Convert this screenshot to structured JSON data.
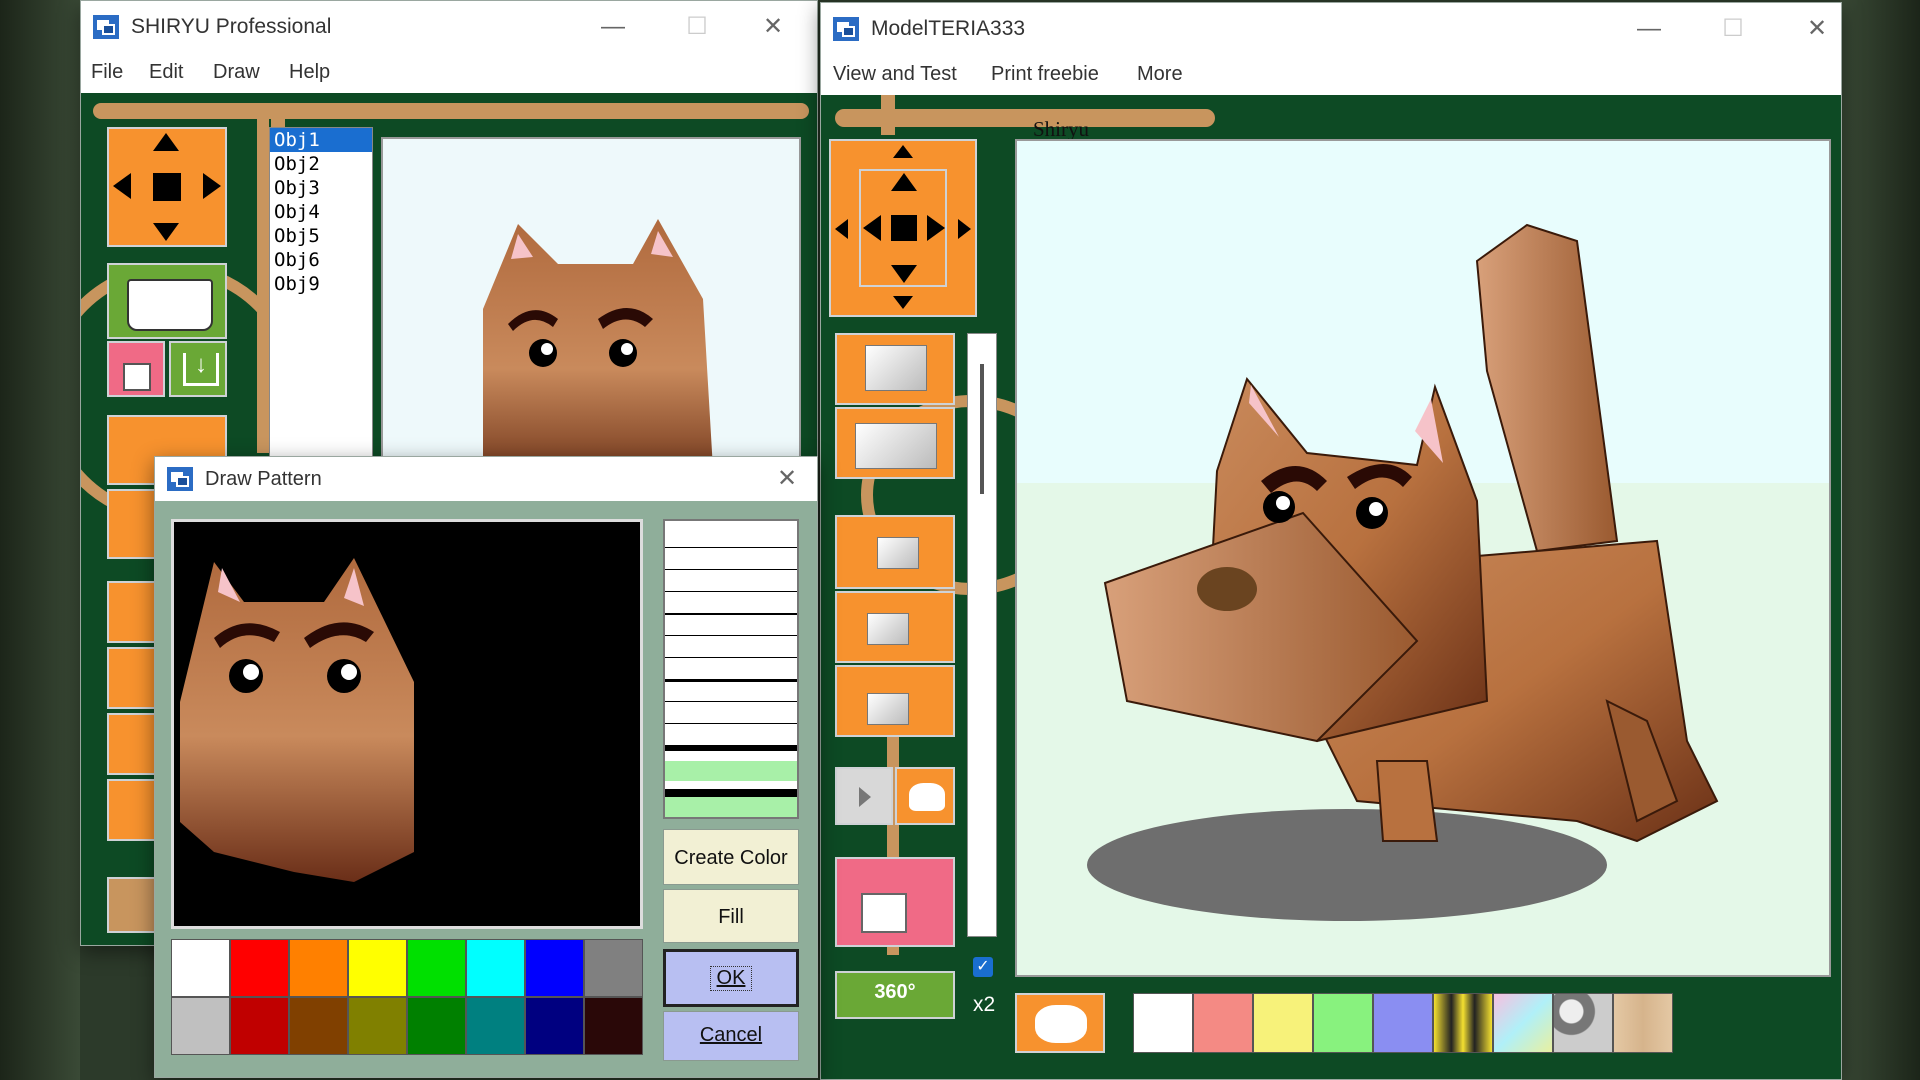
{
  "win1": {
    "title": "SHIRYU Professional",
    "menu": [
      "File",
      "Edit",
      "Draw",
      "Help"
    ],
    "objects": [
      "Obj1",
      "Obj2",
      "Obj3",
      "Obj4",
      "Obj5",
      "Obj6",
      "Obj9"
    ],
    "selected_object": "Obj1"
  },
  "win2": {
    "title": "ModelTERIA333",
    "menu": [
      "View and Test",
      "Print freebie",
      "More"
    ],
    "view_label": "Shiryu",
    "rotate_label": "360°",
    "zoom_label": "x2",
    "checkbox_checked": true,
    "texture_swatches": [
      "#ffffff",
      "#f48a84",
      "#f7f27a",
      "#88f27e",
      "#8a8ef2",
      "texture-fire",
      "texture-gradient",
      "texture-stone",
      "texture-wood"
    ]
  },
  "dialog": {
    "title": "Draw Pattern",
    "buttons": {
      "create_color": "Create Color",
      "fill": "Fill",
      "ok": "OK",
      "cancel": "Cancel"
    },
    "palette": [
      "#ffffff",
      "#ff0000",
      "#ff8000",
      "#ffff00",
      "#00e000",
      "#00ffff",
      "#0000ff",
      "#808080",
      "#c0c0c0",
      "#c00000",
      "#804000",
      "#808000",
      "#008000",
      "#008080",
      "#000080",
      "#2a0808"
    ]
  },
  "colors": {
    "panel_green": "#0d4a24",
    "board_brown": "#c8955e",
    "tool_orange": "#f7922e",
    "accent_blue": "#1a6ed0"
  }
}
